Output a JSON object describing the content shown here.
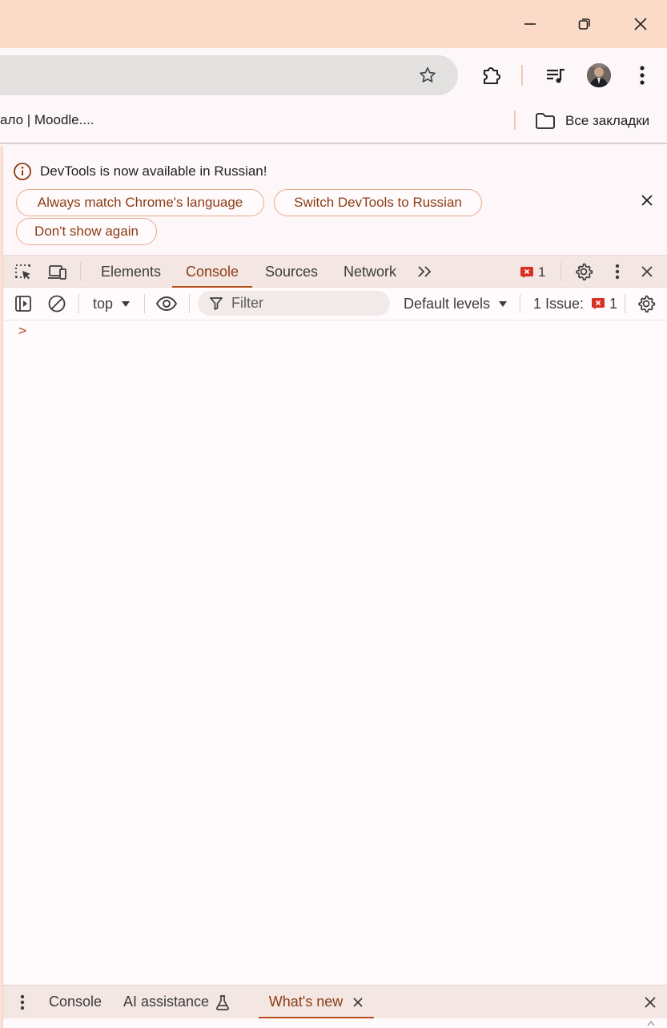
{
  "window": {
    "titlebar_color": "#fcdac8",
    "controls": [
      "minimize-icon",
      "restore-icon",
      "close-icon"
    ]
  },
  "bookmarks": {
    "partial_item": "ало | Moodle....",
    "all_bookmarks": "Все закладки"
  },
  "infobar": {
    "message": "DevTools is now available in Russian!",
    "btn_match": "Always match Chrome's language",
    "btn_switch": "Switch DevTools to Russian",
    "btn_dont_show": "Don't show again"
  },
  "tabs": {
    "items": [
      "Elements",
      "Console",
      "Sources",
      "Network"
    ],
    "active": "Console",
    "error_count": "1"
  },
  "console_toolbar": {
    "context": "top",
    "filter_placeholder": "Filter",
    "levels": "Default levels",
    "issues_label": "1 Issue:",
    "issues_count": "1"
  },
  "prompt": ">",
  "drawer": {
    "tab_console": "Console",
    "tab_ai": "AI assistance",
    "tab_whats_new": "What's new",
    "active": "What's new"
  },
  "colors": {
    "accent": "#b5501c",
    "accent_text": "#8b3d13",
    "error_red": "#d93025"
  }
}
